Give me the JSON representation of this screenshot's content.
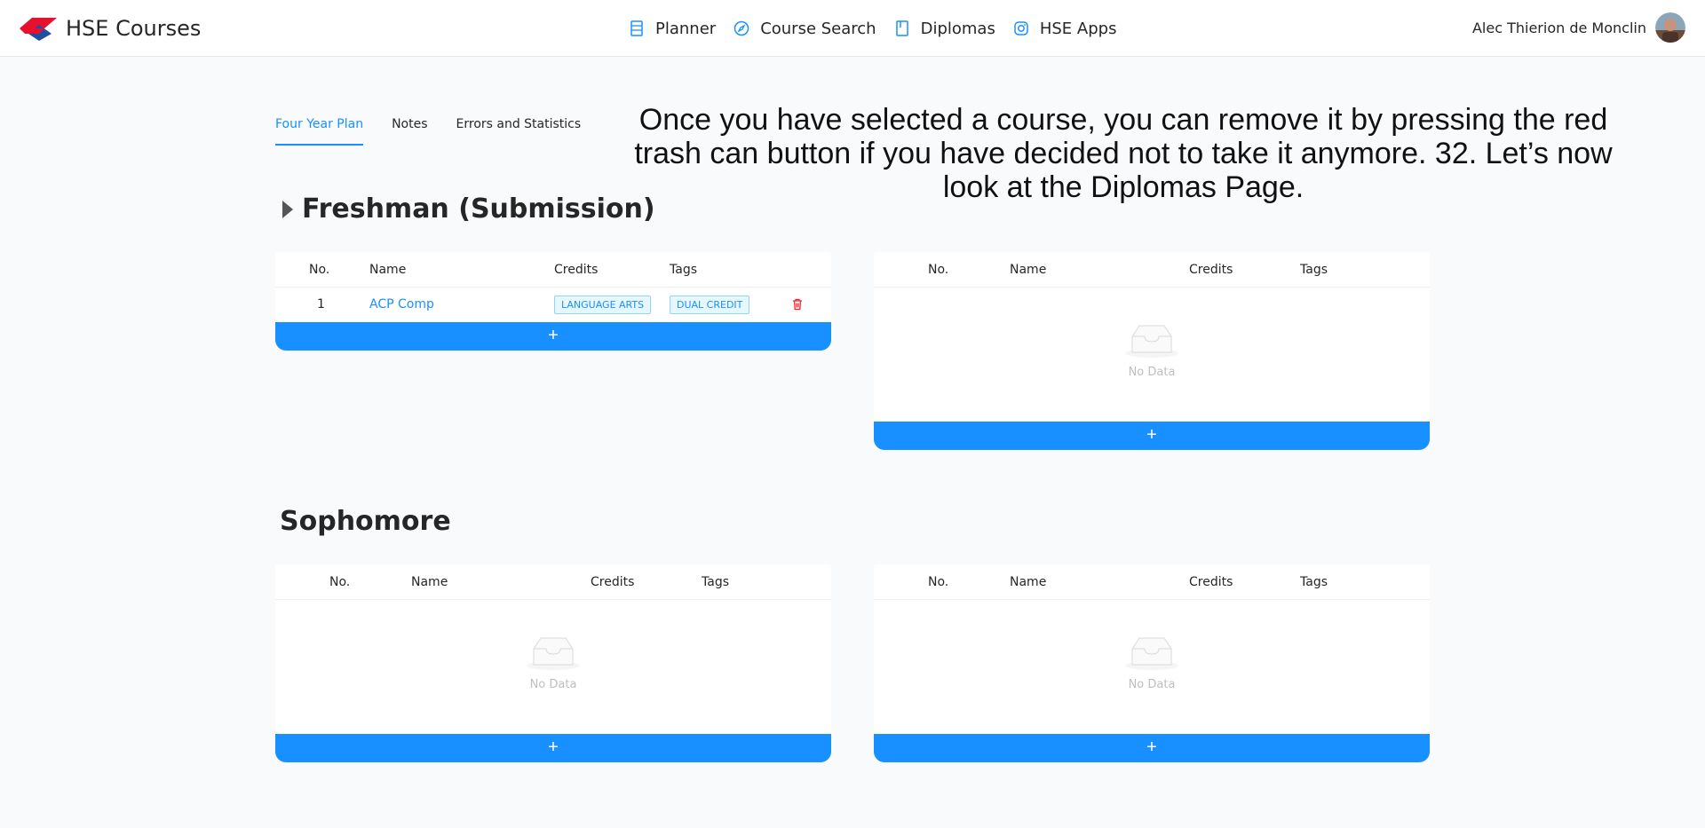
{
  "header": {
    "brand": "HSE Courses",
    "nav": [
      {
        "label": "Planner",
        "icon": "planner-icon"
      },
      {
        "label": "Course Search",
        "icon": "compass-icon"
      },
      {
        "label": "Diplomas",
        "icon": "book-icon"
      },
      {
        "label": "HSE Apps",
        "icon": "instagram-icon"
      }
    ],
    "user_name": "Alec Thierion de Monclin"
  },
  "tabs": [
    {
      "label": "Four Year Plan",
      "active": true
    },
    {
      "label": "Notes",
      "active": false
    },
    {
      "label": "Errors and Statistics",
      "active": false
    }
  ],
  "caption": "Once you have selected a course, you can remove it by pressing the red trash can button if you have decided not to take it anymore. 32. Let’s now look at the Diplomas Page.",
  "table_headers": {
    "no": "No.",
    "name": "Name",
    "credits": "Credits",
    "tags": "Tags"
  },
  "empty_text": "No Data",
  "add_label": "+",
  "freshman": {
    "title": "Freshman (Submission)",
    "semester1_rows": [
      {
        "no": "1",
        "name": "ACP Comp",
        "credits": "LANGUAGE ARTS",
        "tag": "DUAL CREDIT"
      }
    ]
  },
  "sophomore": {
    "title": "Sophomore"
  },
  "colors": {
    "accent": "#1890ff",
    "danger": "#f5222d"
  }
}
